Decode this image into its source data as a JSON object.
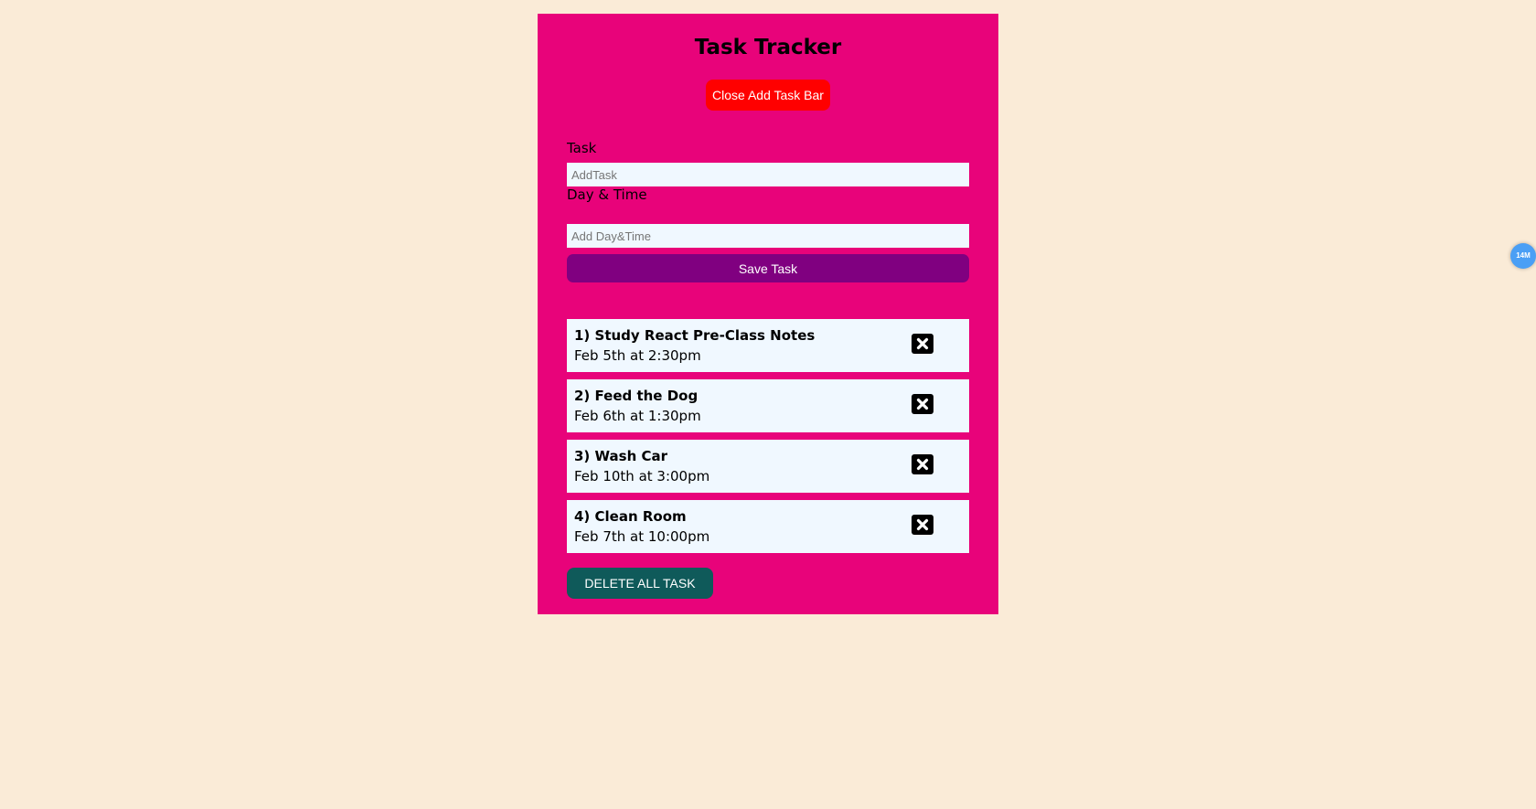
{
  "header": {
    "title": "Task Tracker",
    "toggle_label": "Close Add Task Bar"
  },
  "form": {
    "task_label": "Task",
    "task_placeholder": "AddTask",
    "task_value": "",
    "daytime_label": "Day & Time",
    "daytime_placeholder": "Add Day&Time",
    "daytime_value": "",
    "save_label": "Save Task"
  },
  "tasks": [
    {
      "name": "1) Study React Pre-Class Notes",
      "time": "Feb 5th at 2:30pm"
    },
    {
      "name": "2) Feed the Dog",
      "time": "Feb 6th at 1:30pm"
    },
    {
      "name": "3) Wash Car",
      "time": "Feb 10th at 3:00pm"
    },
    {
      "name": "4) Clean Room",
      "time": "Feb 7th at 10:00pm"
    }
  ],
  "footer": {
    "delete_all_label": "DELETE ALL TASK"
  },
  "extension_badge": {
    "label": "14M"
  },
  "icons": {
    "delete": "close-square-icon"
  },
  "colors": {
    "page_bg": "#faebd7",
    "panel_bg": "#e8037a",
    "toggle_btn": "#ff0000",
    "save_btn": "#800080",
    "task_bg": "#f0f8ff",
    "delete_all_btn": "#0f5a5a",
    "badge": "#4a9ff5"
  }
}
